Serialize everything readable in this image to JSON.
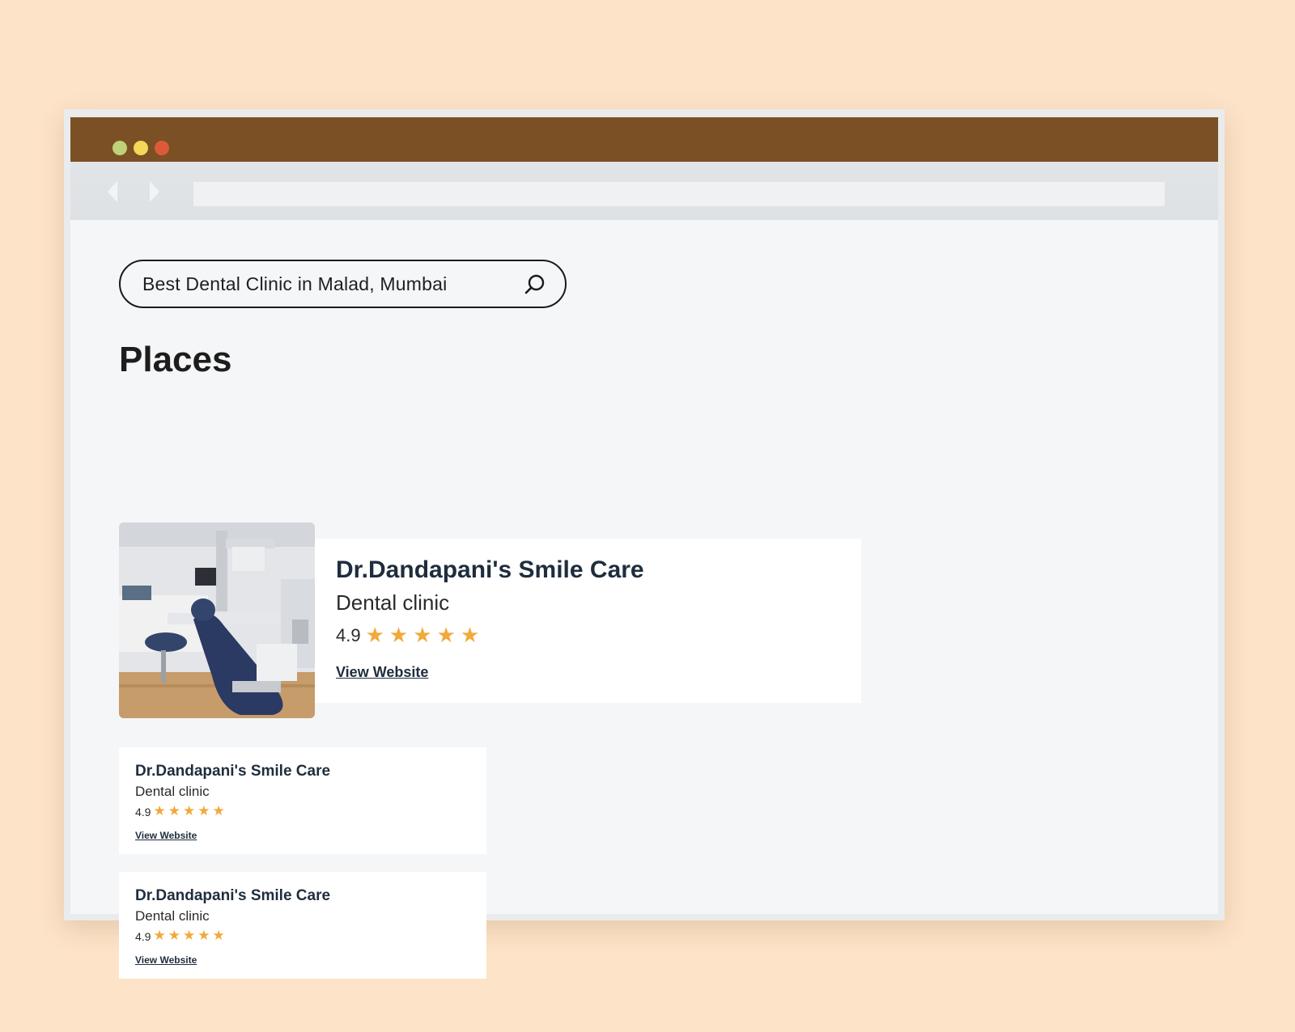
{
  "search": {
    "query": "Best Dental Clinic in Malad, Mumbai",
    "icon": "search-icon"
  },
  "section": {
    "title": "Places"
  },
  "places": [
    {
      "name": "Dr.Dandapani's Smile Care",
      "type": "Dental clinic",
      "rating": "4.9",
      "stars": 5,
      "link_label": "View Website",
      "image": "dental-clinic-photo"
    },
    {
      "name": "Dr.Dandapani's Smile Care",
      "type": "Dental clinic",
      "rating": "4.9",
      "stars": 5,
      "link_label": "View Website"
    },
    {
      "name": "Dr.Dandapani's Smile Care",
      "type": "Dental clinic",
      "rating": "4.9",
      "stars": 5,
      "link_label": "View Website"
    }
  ],
  "colors": {
    "page_background": "#fde3c8",
    "title_bar": "#7b5024",
    "traffic_green": "#bfd27a",
    "traffic_yellow": "#f3d85a",
    "traffic_red": "#dc5a3a",
    "star": "#f2a93b",
    "heading": "#1d1d1d",
    "card_text": "#1f2d3d"
  }
}
